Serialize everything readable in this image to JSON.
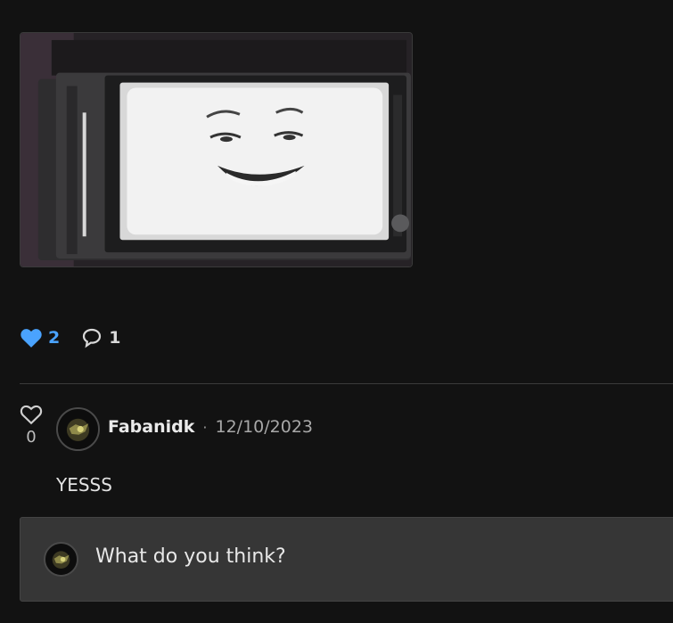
{
  "post": {
    "likes": "2",
    "comments": "1",
    "liked": true
  },
  "comment": {
    "like_count": "0",
    "author": "Fabanidk",
    "separator": "·",
    "date": "12/10/2023",
    "text": "YESSS"
  },
  "reply": {
    "placeholder": "What do you think?"
  },
  "colors": {
    "background": "#121212",
    "like_accent": "#4aa3ff",
    "reply_box": "#363636"
  },
  "icons": {
    "like": "heart-icon",
    "comment": "speech-bubble-icon",
    "comment_like": "heart-outline-icon"
  }
}
